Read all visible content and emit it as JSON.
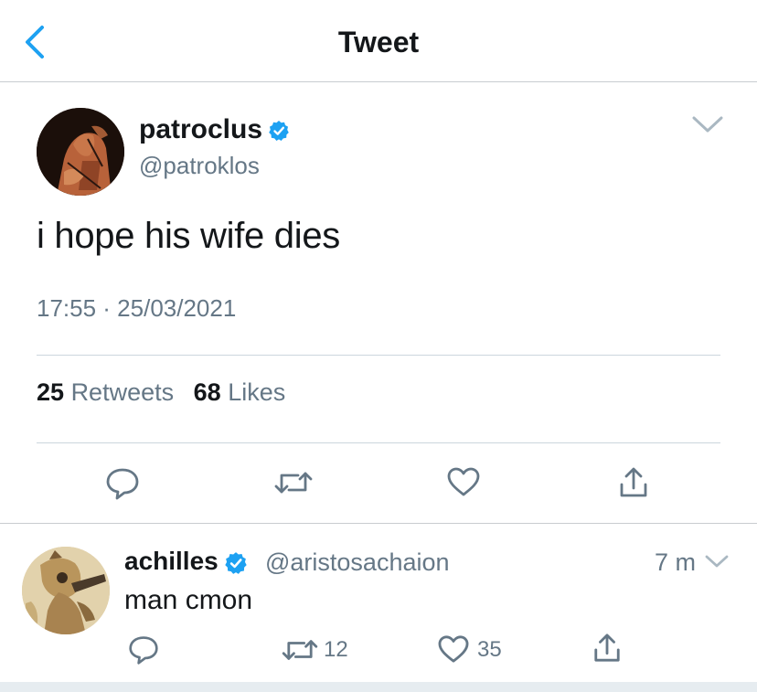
{
  "header": {
    "title": "Tweet"
  },
  "tweet": {
    "display_name": "patroclus",
    "handle": "@patroklos",
    "text": "i hope his wife dies",
    "timestamp": "17:55 · 25/03/2021",
    "stats": {
      "retweets_count": "25",
      "retweets_label": "Retweets",
      "likes_count": "68",
      "likes_label": "Likes"
    }
  },
  "reply": {
    "display_name": "achilles",
    "handle": "@aristosachaion",
    "time": "7 m",
    "text": "man cmon",
    "retweet_count": "12",
    "like_count": "35"
  },
  "colors": {
    "accent": "#1da1f2",
    "secondary_text": "#657786",
    "divider": "#ccd6dd"
  },
  "icons": [
    "back-chevron-icon",
    "verified-badge-icon",
    "chevron-down-icon",
    "reply-icon",
    "retweet-icon",
    "like-icon",
    "share-icon"
  ]
}
